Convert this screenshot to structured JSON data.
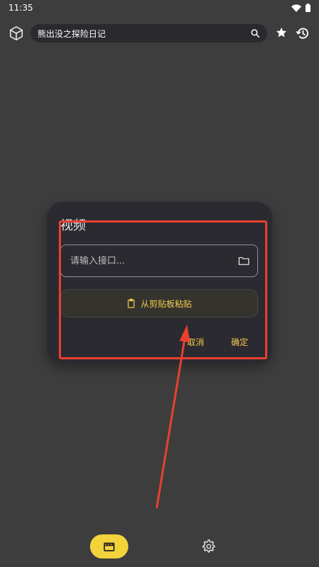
{
  "status_bar": {
    "time": "11:35"
  },
  "search": {
    "query": "熊出没之探险日记"
  },
  "dialog": {
    "title": "视频",
    "input_placeholder": "请输入接口...",
    "input_value": "",
    "paste_label": "从剪贴板粘贴",
    "cancel_label": "取消",
    "ok_label": "确定"
  },
  "colors": {
    "accent": "#f2d33a",
    "background": "#3d3d3d",
    "dialog_bg": "#2b2a30",
    "annotation": "#e8402f"
  },
  "icons": [
    "cube-icon",
    "search-icon",
    "star-icon",
    "history-icon",
    "folder-icon",
    "clipboard-icon",
    "video-icon",
    "gear-icon",
    "wifi-icon",
    "battery-icon"
  ]
}
